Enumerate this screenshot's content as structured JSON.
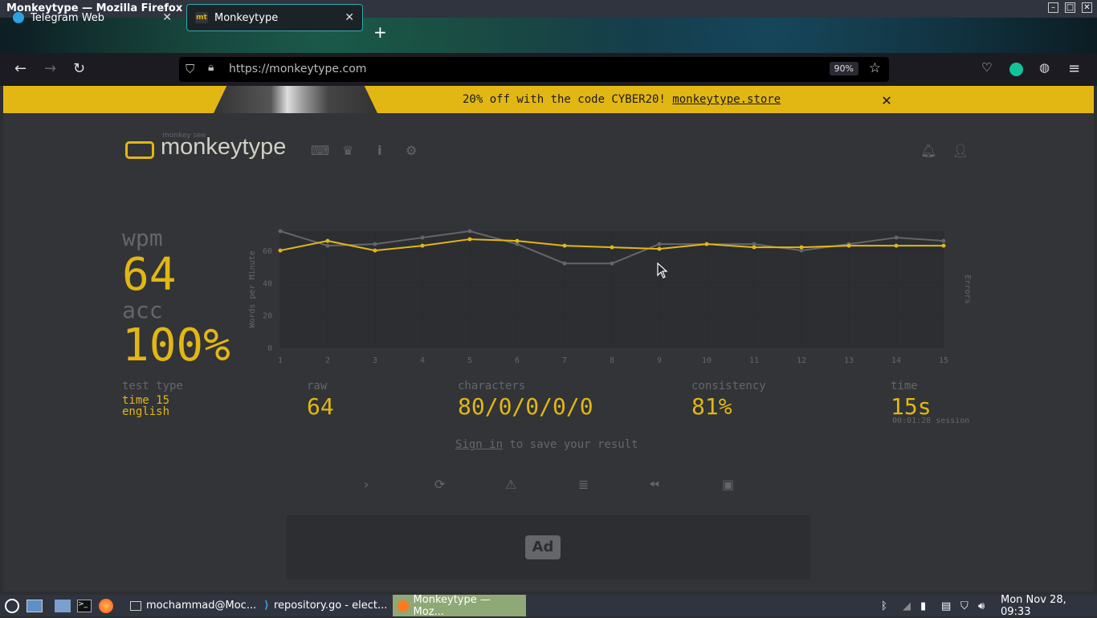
{
  "window": {
    "title": "Monkeytype — Mozilla Firefox"
  },
  "tabs": [
    {
      "label": "Telegram Web",
      "active": false
    },
    {
      "label": "Monkeytype",
      "active": true
    }
  ],
  "urlbar": {
    "url": "https://monkeytype.com",
    "zoom": "90%"
  },
  "banner": {
    "text": "20% off with the code CYBER20! ",
    "link": "monkeytype.store"
  },
  "logo": {
    "name": "monkeytype",
    "subtitle": "monkey see"
  },
  "results": {
    "wpm_label": "wpm",
    "wpm": "64",
    "acc_label": "acc",
    "acc": "100%",
    "test_type_label": "test type",
    "test_type": "time 15",
    "language": "english",
    "raw_label": "raw",
    "raw": "64",
    "characters_label": "characters",
    "characters": "80/0/0/0/0",
    "consistency_label": "consistency",
    "consistency": "81%",
    "time_label": "time",
    "time": "15s",
    "session": "00:01:28 session"
  },
  "signin": {
    "link": "Sign in",
    "text": " to save your result"
  },
  "ad": {
    "label": "Ad"
  },
  "taskbar": {
    "apps": [
      {
        "label": "mochammad@Moc..."
      },
      {
        "label": "repository.go - elect..."
      },
      {
        "label": "Monkeytype — Moz..."
      }
    ],
    "clock": "Mon Nov 28, 09:33"
  },
  "chart_data": {
    "type": "line",
    "x": [
      1,
      2,
      3,
      4,
      5,
      6,
      7,
      8,
      9,
      10,
      11,
      12,
      13,
      14,
      15
    ],
    "ylabel": "Words per Minute",
    "y2label": "Errors",
    "ylim": [
      0,
      72
    ],
    "yticks": [
      0,
      20,
      40,
      60
    ],
    "series": [
      {
        "name": "wpm",
        "color": "#e2b714",
        "values": [
          60,
          66,
          60,
          63,
          67,
          66,
          63,
          62,
          61,
          64,
          62,
          62,
          63,
          63,
          63
        ]
      },
      {
        "name": "raw",
        "color": "#646669",
        "values": [
          72,
          63,
          64,
          68,
          72,
          64,
          52,
          52,
          64,
          64,
          64,
          60,
          64,
          68,
          66
        ]
      }
    ],
    "grid": true
  }
}
